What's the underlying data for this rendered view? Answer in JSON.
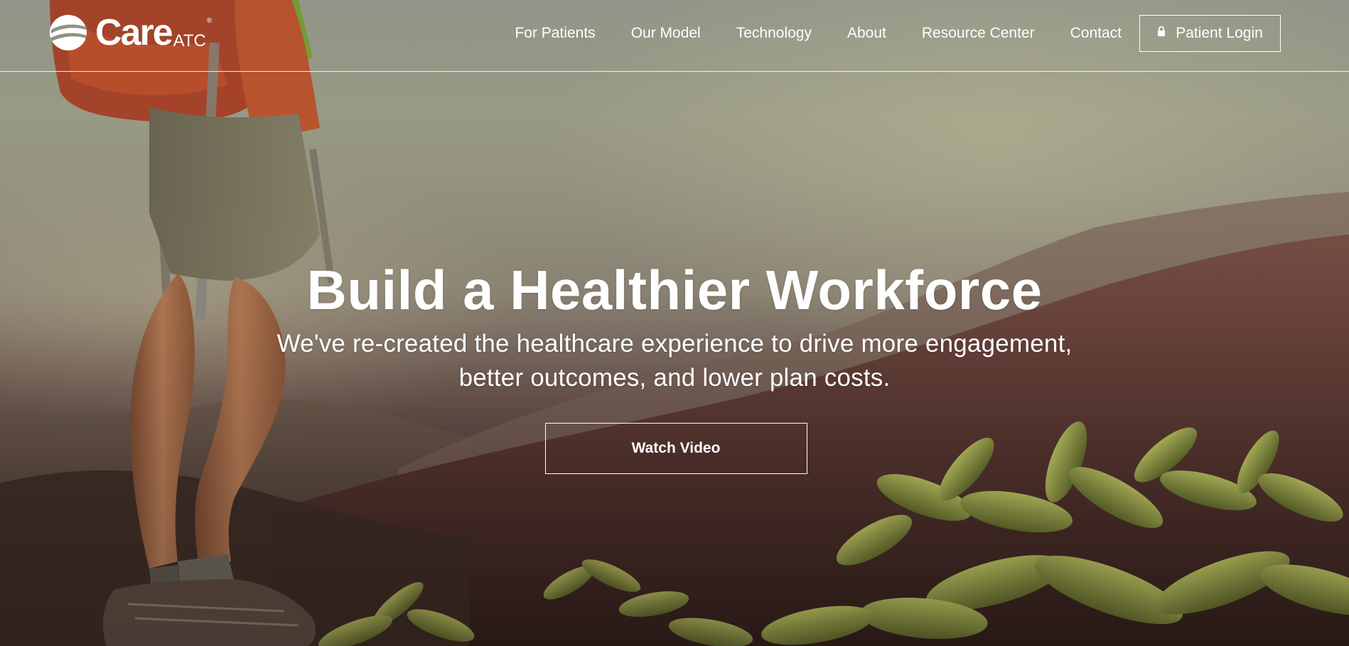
{
  "logo": {
    "word": "Care",
    "sub": "ATC",
    "registered": "®"
  },
  "nav": {
    "items": [
      {
        "label": "For Patients"
      },
      {
        "label": "Our Model"
      },
      {
        "label": "Technology"
      },
      {
        "label": "About"
      },
      {
        "label": "Resource Center"
      },
      {
        "label": "Contact"
      }
    ],
    "login": {
      "label": "Patient Login",
      "icon": "lock-icon"
    }
  },
  "hero": {
    "title": "Build a Healthier Workforce",
    "subtitle_line1": "We've re-created the healthcare experience to drive more engagement,",
    "subtitle_line2": "better outcomes, and lower plan costs.",
    "cta_label": "Watch Video"
  },
  "colors": {
    "text": "#ffffff",
    "sky": "#9ea294",
    "mountain": "#5a3a34",
    "foliage": "#9aa444"
  }
}
